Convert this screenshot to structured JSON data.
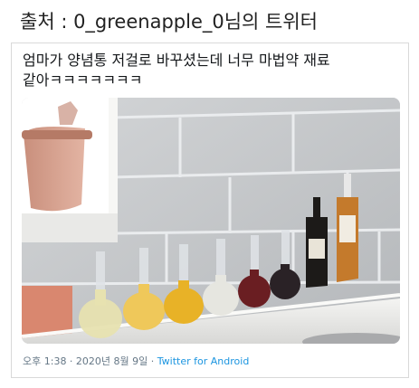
{
  "header": {
    "source_line": "출처 : 0_greenapple_0님의 트위터"
  },
  "tweet": {
    "text": "엄마가 양념통 저걸로 바꾸셨는데 너무 마법약 재료 같아ㅋㅋㅋㅋㅋㅋㅋ",
    "timestamp": "오후 1:38 · 2020년 8월 9일",
    "separator": " · ",
    "source_app": "Twitter for Android"
  },
  "photo": {
    "bottle_colors": [
      "#e7e2b0",
      "#efc85a",
      "#e8b227",
      "#e6e6e0",
      "#6a1e22",
      "#2a2226"
    ],
    "tall_bottle_colors": [
      "#1c1a18",
      "#c47a2c"
    ]
  }
}
